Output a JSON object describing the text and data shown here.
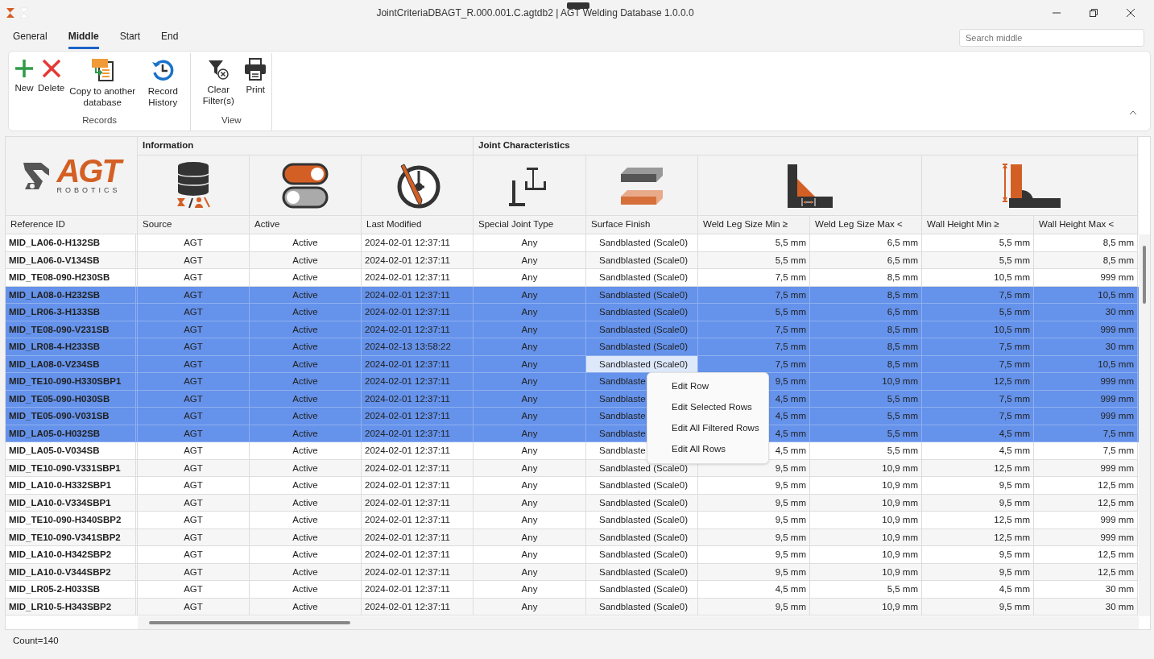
{
  "window": {
    "title": "JointCriteriaDBAGT_R.000.001.C.agtdb2 | AGT Welding Database 1.0.0.0"
  },
  "tabs": [
    {
      "label": "General",
      "selected": false
    },
    {
      "label": "Middle",
      "selected": true
    },
    {
      "label": "Start",
      "selected": false
    },
    {
      "label": "End",
      "selected": false
    }
  ],
  "search": {
    "placeholder": "Search middle"
  },
  "ribbon": {
    "groups": [
      {
        "label": "Records",
        "buttons": [
          {
            "label": "New",
            "kind": "new"
          },
          {
            "label": "Delete",
            "kind": "delete"
          },
          {
            "label": "Copy to another database",
            "kind": "copy"
          },
          {
            "label": "Record History",
            "kind": "history"
          }
        ]
      },
      {
        "label": "View",
        "buttons": [
          {
            "label": "Clear Filter(s)",
            "kind": "clear-filter"
          },
          {
            "label": "Print",
            "kind": "print"
          }
        ]
      }
    ]
  },
  "grid": {
    "logo": {
      "text": "AGT",
      "subtext": "ROBOTICS"
    },
    "column_groups": [
      {
        "columns": [
          {
            "label": "Reference ID"
          }
        ]
      },
      {
        "label": "Information",
        "columns": [
          {
            "label": "Source"
          },
          {
            "label": "Active"
          },
          {
            "label": "Last Modified"
          }
        ]
      },
      {
        "label": "Joint Characteristics",
        "columns": [
          {
            "label": "Special Joint Type"
          },
          {
            "label": "Surface Finish"
          },
          {
            "label": "Weld Leg Size Min ≥"
          },
          {
            "label": "Weld Leg Size Max <"
          },
          {
            "label": "Wall Height Min ≥"
          },
          {
            "label": "Wall Height Max <"
          }
        ]
      }
    ],
    "rows": [
      {
        "selected": false,
        "cells": [
          "MID_LA06-0-H132SB",
          "AGT",
          "Active",
          "2024-02-01 12:37:11",
          "Any",
          "Sandblasted (Scale0)",
          "5,5 mm",
          "6,5 mm",
          "5,5 mm",
          "8,5 mm"
        ]
      },
      {
        "selected": false,
        "cells": [
          "MID_LA06-0-V134SB",
          "AGT",
          "Active",
          "2024-02-01 12:37:11",
          "Any",
          "Sandblasted (Scale0)",
          "5,5 mm",
          "6,5 mm",
          "5,5 mm",
          "8,5 mm"
        ]
      },
      {
        "selected": false,
        "cells": [
          "MID_TE08-090-H230SB",
          "AGT",
          "Active",
          "2024-02-01 12:37:11",
          "Any",
          "Sandblasted (Scale0)",
          "7,5 mm",
          "8,5 mm",
          "10,5 mm",
          "999 mm"
        ]
      },
      {
        "selected": true,
        "cells": [
          "MID_LA08-0-H232SB",
          "AGT",
          "Active",
          "2024-02-01 12:37:11",
          "Any",
          "Sandblasted (Scale0)",
          "7,5 mm",
          "8,5 mm",
          "7,5 mm",
          "10,5 mm"
        ]
      },
      {
        "selected": true,
        "cells": [
          "MID_LR06-3-H133SB",
          "AGT",
          "Active",
          "2024-02-01 12:37:11",
          "Any",
          "Sandblasted (Scale0)",
          "5,5 mm",
          "6,5 mm",
          "5,5 mm",
          "30 mm"
        ]
      },
      {
        "selected": true,
        "cells": [
          "MID_TE08-090-V231SB",
          "AGT",
          "Active",
          "2024-02-01 12:37:11",
          "Any",
          "Sandblasted (Scale0)",
          "7,5 mm",
          "8,5 mm",
          "10,5 mm",
          "999 mm"
        ]
      },
      {
        "selected": true,
        "cells": [
          "MID_LR08-4-H233SB",
          "AGT",
          "Active",
          "2024-02-13 13:58:22",
          "Any",
          "Sandblasted (Scale0)",
          "7,5 mm",
          "8,5 mm",
          "7,5 mm",
          "30 mm"
        ]
      },
      {
        "selected": true,
        "cells": [
          "MID_LA08-0-V234SB",
          "AGT",
          "Active",
          "2024-02-01 12:37:11",
          "Any",
          {
            "text": "Sandblasted (Scale0)",
            "focused": true
          },
          "7,5 mm",
          "8,5 mm",
          "7,5 mm",
          "10,5 mm"
        ]
      },
      {
        "selected": true,
        "cells": [
          "MID_TE10-090-H330SBP1",
          "AGT",
          "Active",
          "2024-02-01 12:37:11",
          "Any",
          "Sandblaste",
          "9,5 mm",
          "10,9 mm",
          "12,5 mm",
          "999 mm"
        ]
      },
      {
        "selected": true,
        "cells": [
          "MID_TE05-090-H030SB",
          "AGT",
          "Active",
          "2024-02-01 12:37:11",
          "Any",
          "Sandblaste",
          "4,5 mm",
          "5,5 mm",
          "7,5 mm",
          "999 mm"
        ]
      },
      {
        "selected": true,
        "cells": [
          "MID_TE05-090-V031SB",
          "AGT",
          "Active",
          "2024-02-01 12:37:11",
          "Any",
          "Sandblaste",
          "4,5 mm",
          "5,5 mm",
          "7,5 mm",
          "999 mm"
        ]
      },
      {
        "selected": true,
        "cells": [
          "MID_LA05-0-H032SB",
          "AGT",
          "Active",
          "2024-02-01 12:37:11",
          "Any",
          "Sandblaste",
          "4,5 mm",
          "5,5 mm",
          "4,5 mm",
          "7,5 mm"
        ]
      },
      {
        "selected": false,
        "cells": [
          "MID_LA05-0-V034SB",
          "AGT",
          "Active",
          "2024-02-01 12:37:11",
          "Any",
          "Sandblaste",
          "4,5 mm",
          "5,5 mm",
          "4,5 mm",
          "7,5 mm"
        ]
      },
      {
        "selected": false,
        "cells": [
          "MID_TE10-090-V331SBP1",
          "AGT",
          "Active",
          "2024-02-01 12:37:11",
          "Any",
          "Sandblasted (Scale0)",
          "9,5 mm",
          "10,9 mm",
          "12,5 mm",
          "999 mm"
        ]
      },
      {
        "selected": false,
        "cells": [
          "MID_LA10-0-H332SBP1",
          "AGT",
          "Active",
          "2024-02-01 12:37:11",
          "Any",
          "Sandblasted (Scale0)",
          "9,5 mm",
          "10,9 mm",
          "9,5 mm",
          "12,5 mm"
        ]
      },
      {
        "selected": false,
        "cells": [
          "MID_LA10-0-V334SBP1",
          "AGT",
          "Active",
          "2024-02-01 12:37:11",
          "Any",
          "Sandblasted (Scale0)",
          "9,5 mm",
          "10,9 mm",
          "9,5 mm",
          "12,5 mm"
        ]
      },
      {
        "selected": false,
        "cells": [
          "MID_TE10-090-H340SBP2",
          "AGT",
          "Active",
          "2024-02-01 12:37:11",
          "Any",
          "Sandblasted (Scale0)",
          "9,5 mm",
          "10,9 mm",
          "12,5 mm",
          "999 mm"
        ]
      },
      {
        "selected": false,
        "cells": [
          "MID_TE10-090-V341SBP2",
          "AGT",
          "Active",
          "2024-02-01 12:37:11",
          "Any",
          "Sandblasted (Scale0)",
          "9,5 mm",
          "10,9 mm",
          "12,5 mm",
          "999 mm"
        ]
      },
      {
        "selected": false,
        "cells": [
          "MID_LA10-0-H342SBP2",
          "AGT",
          "Active",
          "2024-02-01 12:37:11",
          "Any",
          "Sandblasted (Scale0)",
          "9,5 mm",
          "10,9 mm",
          "9,5 mm",
          "12,5 mm"
        ]
      },
      {
        "selected": false,
        "cells": [
          "MID_LA10-0-V344SBP2",
          "AGT",
          "Active",
          "2024-02-01 12:37:11",
          "Any",
          "Sandblasted (Scale0)",
          "9,5 mm",
          "10,9 mm",
          "9,5 mm",
          "12,5 mm"
        ]
      },
      {
        "selected": false,
        "cells": [
          "MID_LR05-2-H033SB",
          "AGT",
          "Active",
          "2024-02-01 12:37:11",
          "Any",
          "Sandblasted (Scale0)",
          "4,5 mm",
          "5,5 mm",
          "4,5 mm",
          "30 mm"
        ]
      },
      {
        "selected": false,
        "cells": [
          "MID_LR10-5-H343SBP2",
          "AGT",
          "Active",
          "2024-02-01 12:37:11",
          "Any",
          "Sandblasted (Scale0)",
          "9,5 mm",
          "10,9 mm",
          "9,5 mm",
          "30 mm"
        ]
      }
    ]
  },
  "context_menu": {
    "items": [
      {
        "label": "Edit Row"
      },
      {
        "label": "Edit Selected Rows"
      },
      {
        "label": "Edit All Filtered Rows"
      },
      {
        "label": "Edit All Rows"
      }
    ]
  },
  "status_bar": {
    "count": "Count=140"
  }
}
